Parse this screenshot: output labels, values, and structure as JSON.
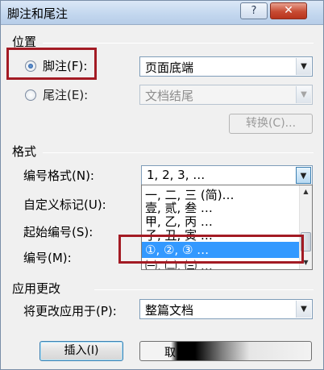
{
  "window": {
    "title": "脚注和尾注",
    "help_label": "?",
    "close_label": "✕"
  },
  "location": {
    "section_label": "位置",
    "footnote": {
      "label": "脚注(F):",
      "selected": true,
      "value": "页面底端"
    },
    "endnote": {
      "label": "尾注(E):",
      "selected": false,
      "value": "文档结尾"
    },
    "convert_button": "转换(C)..."
  },
  "format": {
    "section_label": "格式",
    "number_format": {
      "label": "编号格式(N):",
      "value": "1, 2, 3, …"
    },
    "custom_mark": {
      "label": "自定义标记(U):"
    },
    "start_at": {
      "label": "起始编号(S):"
    },
    "numbering": {
      "label": "编号(M):"
    },
    "dropdown_options": [
      "一, 二, 三 (简)…",
      "壹, 贰, 叁 …",
      "甲, 乙, 丙 …",
      "子, 丑, 寅 …",
      "①, ②, ③ …",
      "㈠, ㈡, ㈢ …"
    ],
    "selected_option_index": 4
  },
  "apply": {
    "section_label": "应用更改",
    "apply_to": {
      "label": "将更改应用于(P):",
      "value": "整篇文档"
    }
  },
  "buttons": {
    "insert": "插入(I)",
    "second": "取"
  },
  "icons": {
    "combo_arrow": "▼",
    "scroll_up": "▲",
    "scroll_down": "▼"
  },
  "colors": {
    "highlight": "#a31b24",
    "selection": "#3399ff"
  }
}
